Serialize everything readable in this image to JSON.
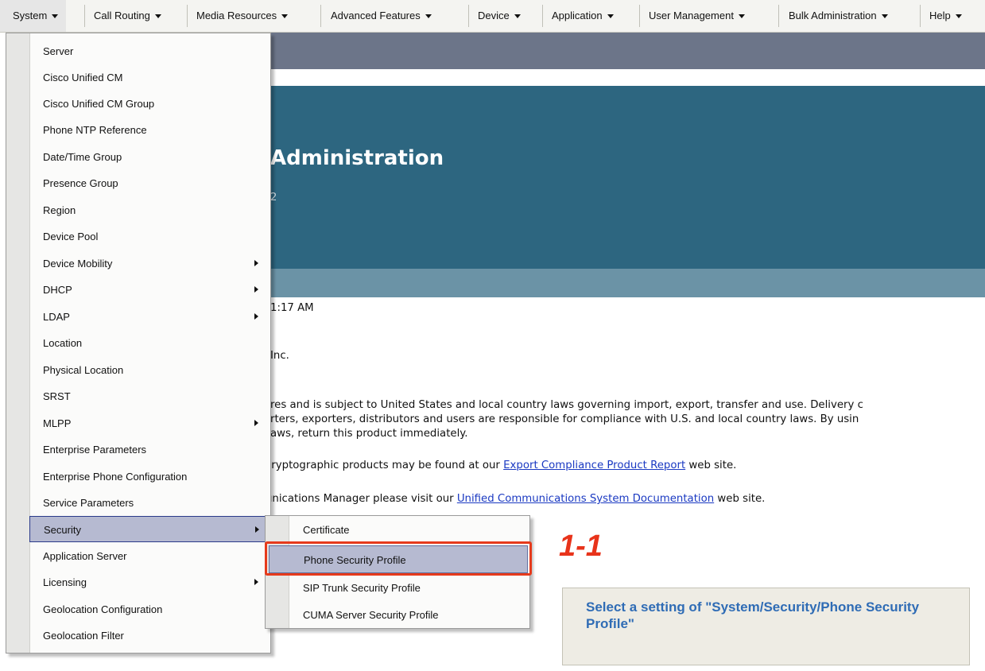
{
  "menubar": {
    "items": [
      {
        "label": "System"
      },
      {
        "label": "Call Routing"
      },
      {
        "label": "Media Resources"
      },
      {
        "label": "Advanced Features"
      },
      {
        "label": "Device"
      },
      {
        "label": "Application"
      },
      {
        "label": "User Management"
      },
      {
        "label": "Bulk Administration"
      },
      {
        "label": "Help"
      }
    ]
  },
  "header": {
    "title": "Administration",
    "subtitle": "2"
  },
  "body": {
    "time": "1:17 AM",
    "inc": "Inc.",
    "line1": "res and is subject to United States and local country laws governing import, export, transfer and use. Delivery c",
    "line2": "rters, exporters, distributors and users are responsible for compliance with U.S. and local country laws. By usin",
    "line3": "aws, return this product immediately.",
    "line4_pre": "cryptographic products may be found at our ",
    "line4_link": "Export Compliance Product Report",
    "line4_post": " web site.",
    "line5_pre": "unications Manager please visit our ",
    "line5_link": "Unified Communications System Documentation",
    "line5_post": " web site."
  },
  "system_menu": {
    "items": [
      {
        "label": "Server"
      },
      {
        "label": "Cisco Unified CM"
      },
      {
        "label": "Cisco Unified CM Group"
      },
      {
        "label": "Phone NTP Reference"
      },
      {
        "label": "Date/Time Group"
      },
      {
        "label": "Presence Group"
      },
      {
        "label": "Region"
      },
      {
        "label": "Device Pool"
      },
      {
        "label": "Device Mobility"
      },
      {
        "label": "DHCP"
      },
      {
        "label": "LDAP"
      },
      {
        "label": "Location"
      },
      {
        "label": "Physical Location"
      },
      {
        "label": "SRST"
      },
      {
        "label": "MLPP"
      },
      {
        "label": "Enterprise Parameters"
      },
      {
        "label": "Enterprise Phone Configuration"
      },
      {
        "label": "Service Parameters"
      },
      {
        "label": "Security"
      },
      {
        "label": "Application Server"
      },
      {
        "label": "Licensing"
      },
      {
        "label": "Geolocation Configuration"
      },
      {
        "label": "Geolocation Filter"
      }
    ]
  },
  "security_submenu": {
    "items": [
      {
        "label": "Certificate"
      },
      {
        "label": "Phone Security Profile"
      },
      {
        "label": "SIP Trunk Security Profile"
      },
      {
        "label": "CUMA Server Security Profile"
      }
    ]
  },
  "annotation": {
    "step": "1-1",
    "note": "Select a setting of \"System/Security/Phone Security Profile\"",
    "highlight_color": "#e63a1c",
    "note_color": "#2f6cb5"
  }
}
